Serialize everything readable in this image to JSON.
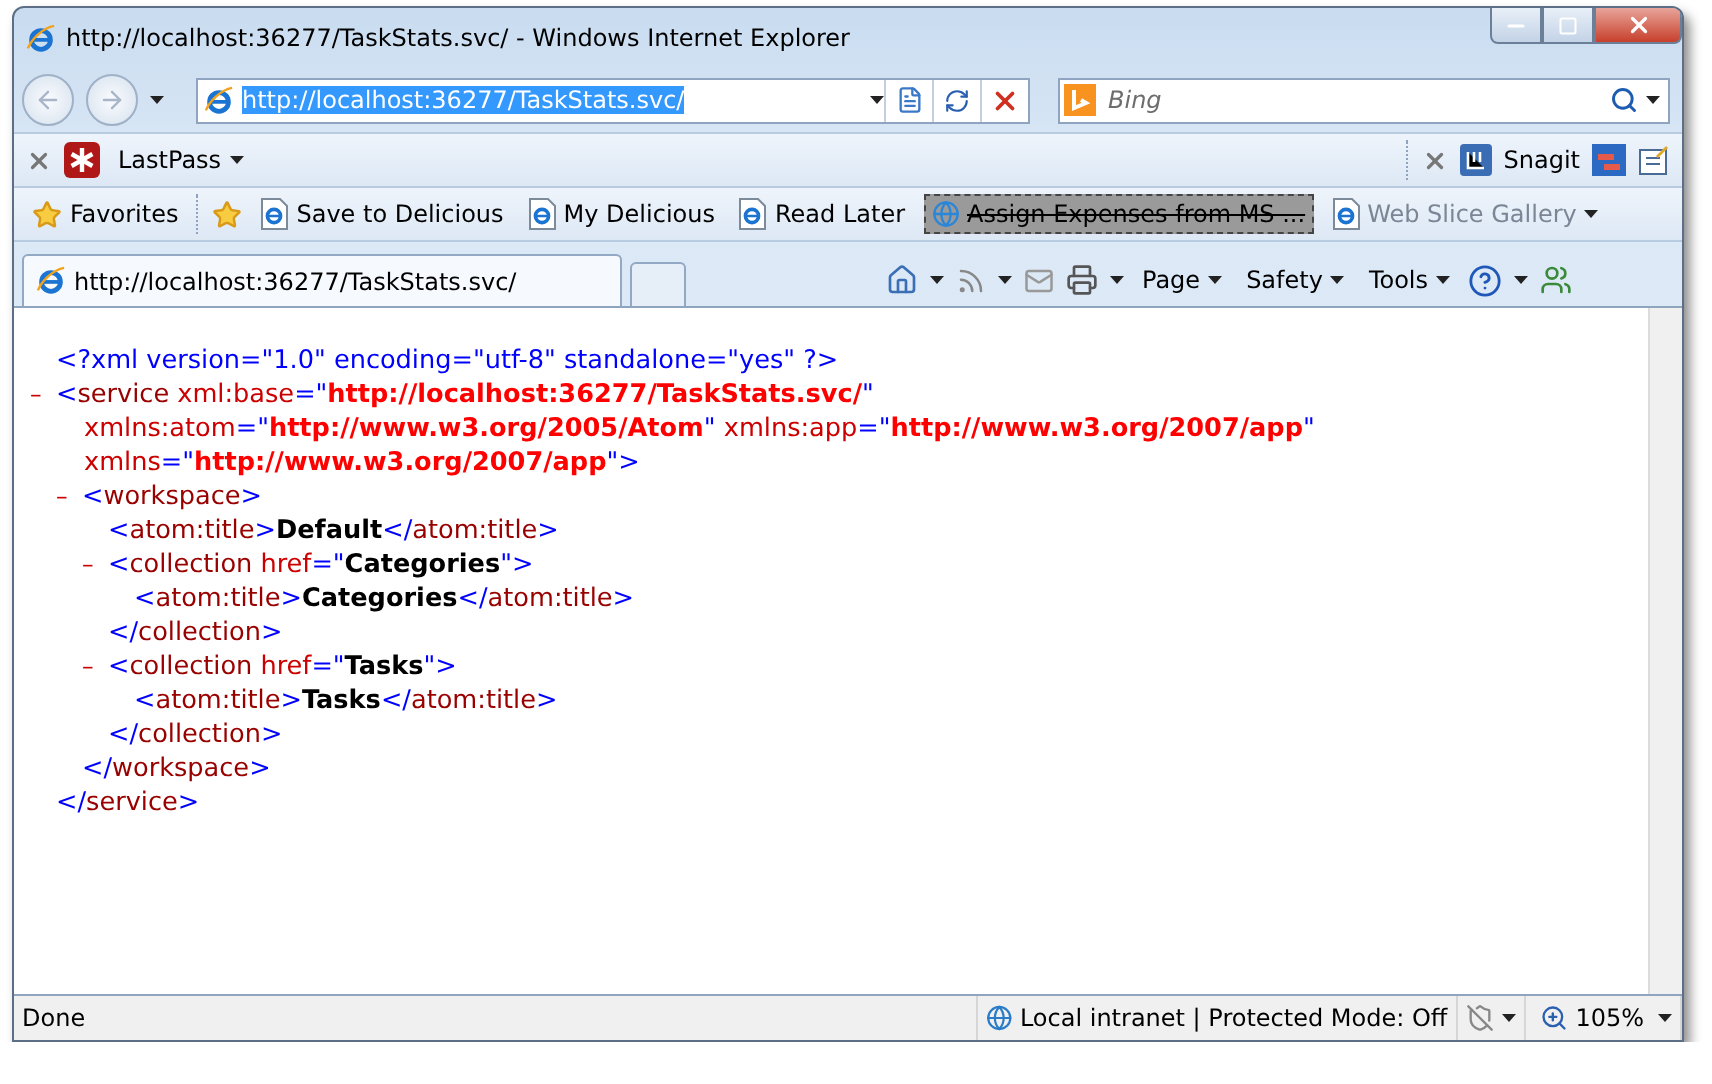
{
  "window": {
    "title": "http://localhost:36277/TaskStats.svc/ - Windows Internet Explorer"
  },
  "address_bar": {
    "value": "http://localhost:36277/TaskStats.svc/",
    "highlighted": true
  },
  "search": {
    "placeholder": "Bing"
  },
  "lastpass_toolbar": {
    "label": "LastPass"
  },
  "snagit_toolbar": {
    "label": "Snagit"
  },
  "favorites_bar": {
    "label": "Favorites",
    "links": [
      {
        "label": "Save to Delicious",
        "kind": "link",
        "disabled": false
      },
      {
        "label": "My Delicious",
        "kind": "link",
        "disabled": false
      },
      {
        "label": "Read Later",
        "kind": "link",
        "disabled": false
      },
      {
        "label": "Assign Expenses from MS ...",
        "kind": "dragging",
        "disabled": false
      },
      {
        "label": "Web Slice Gallery",
        "kind": "menu",
        "disabled": true
      }
    ]
  },
  "tabs": [
    {
      "label": "http://localhost:36277/TaskStats.svc/",
      "selected": true
    }
  ],
  "command_bar": {
    "menus": [
      "Page",
      "Safety",
      "Tools"
    ]
  },
  "document": {
    "prolog": [
      {
        "kind": "punct",
        "text": "<?xml version=\"1.0\" encoding=\"utf-8\" standalone=\"yes\" ?>"
      }
    ],
    "root": {
      "toggle": "–",
      "lines": [
        [
          {
            "kind": "punct",
            "text": "<"
          },
          {
            "kind": "tag",
            "text": "service"
          },
          {
            "kind": "attr",
            "text": " xml:base"
          },
          {
            "kind": "punct",
            "text": "=\""
          },
          {
            "kind": "value",
            "text": "http://localhost:36277/TaskStats.svc/"
          },
          {
            "kind": "punct",
            "text": "\""
          }
        ],
        [
          {
            "kind": "attr",
            "text": "xmlns:atom"
          },
          {
            "kind": "punct",
            "text": "=\""
          },
          {
            "kind": "value",
            "text": "http://www.w3.org/2005/Atom"
          },
          {
            "kind": "punct",
            "text": "\""
          },
          {
            "kind": "attr",
            "text": " xmlns:app"
          },
          {
            "kind": "punct",
            "text": "=\""
          },
          {
            "kind": "value",
            "text": "http://www.w3.org/2007/app"
          },
          {
            "kind": "punct",
            "text": "\""
          }
        ],
        [
          {
            "kind": "attr",
            "text": "xmlns"
          },
          {
            "kind": "punct",
            "text": "=\""
          },
          {
            "kind": "value",
            "text": "http://www.w3.org/2007/app"
          },
          {
            "kind": "punct",
            "text": "\">"
          }
        ]
      ],
      "children": [
        {
          "toggle": "–",
          "lines": [
            [
              {
                "kind": "punct",
                "text": "<"
              },
              {
                "kind": "tag",
                "text": "workspace"
              },
              {
                "kind": "punct",
                "text": ">"
              }
            ]
          ],
          "children": [
            {
              "lines": [
                [
                  {
                    "kind": "punct",
                    "text": "<"
                  },
                  {
                    "kind": "tag",
                    "text": "atom:title"
                  },
                  {
                    "kind": "punct",
                    "text": ">"
                  },
                  {
                    "kind": "text",
                    "text": "Default"
                  },
                  {
                    "kind": "punct",
                    "text": "</"
                  },
                  {
                    "kind": "tag",
                    "text": "atom:title"
                  },
                  {
                    "kind": "punct",
                    "text": ">"
                  }
                ]
              ]
            },
            {
              "toggle": "–",
              "lines": [
                [
                  {
                    "kind": "punct",
                    "text": "<"
                  },
                  {
                    "kind": "tag",
                    "text": "collection"
                  },
                  {
                    "kind": "attr",
                    "text": " href"
                  },
                  {
                    "kind": "punct",
                    "text": "=\""
                  },
                  {
                    "kind": "text",
                    "text": "Categories"
                  },
                  {
                    "kind": "punct",
                    "text": "\">"
                  }
                ]
              ],
              "children": [
                {
                  "lines": [
                    [
                      {
                        "kind": "punct",
                        "text": "<"
                      },
                      {
                        "kind": "tag",
                        "text": "atom:title"
                      },
                      {
                        "kind": "punct",
                        "text": ">"
                      },
                      {
                        "kind": "text",
                        "text": "Categories"
                      },
                      {
                        "kind": "punct",
                        "text": "</"
                      },
                      {
                        "kind": "tag",
                        "text": "atom:title"
                      },
                      {
                        "kind": "punct",
                        "text": ">"
                      }
                    ]
                  ]
                }
              ],
              "close": [
                {
                  "kind": "punct",
                  "text": "</"
                },
                {
                  "kind": "tag",
                  "text": "collection"
                },
                {
                  "kind": "punct",
                  "text": ">"
                }
              ]
            },
            {
              "toggle": "–",
              "lines": [
                [
                  {
                    "kind": "punct",
                    "text": "<"
                  },
                  {
                    "kind": "tag",
                    "text": "collection"
                  },
                  {
                    "kind": "attr",
                    "text": " href"
                  },
                  {
                    "kind": "punct",
                    "text": "=\""
                  },
                  {
                    "kind": "text",
                    "text": "Tasks"
                  },
                  {
                    "kind": "punct",
                    "text": "\">"
                  }
                ]
              ],
              "children": [
                {
                  "lines": [
                    [
                      {
                        "kind": "punct",
                        "text": "<"
                      },
                      {
                        "kind": "tag",
                        "text": "atom:title"
                      },
                      {
                        "kind": "punct",
                        "text": ">"
                      },
                      {
                        "kind": "text",
                        "text": "Tasks"
                      },
                      {
                        "kind": "punct",
                        "text": "</"
                      },
                      {
                        "kind": "tag",
                        "text": "atom:title"
                      },
                      {
                        "kind": "punct",
                        "text": ">"
                      }
                    ]
                  ]
                }
              ],
              "close": [
                {
                  "kind": "punct",
                  "text": "</"
                },
                {
                  "kind": "tag",
                  "text": "collection"
                },
                {
                  "kind": "punct",
                  "text": ">"
                }
              ]
            }
          ],
          "close": [
            {
              "kind": "punct",
              "text": "</"
            },
            {
              "kind": "tag",
              "text": "workspace"
            },
            {
              "kind": "punct",
              "text": ">"
            }
          ]
        }
      ],
      "close": [
        {
          "kind": "punct",
          "text": "</"
        },
        {
          "kind": "tag",
          "text": "service"
        },
        {
          "kind": "punct",
          "text": ">"
        }
      ]
    }
  },
  "status_bar": {
    "status": "Done",
    "zone": "Local intranet | Protected Mode: Off",
    "zoom": "105%"
  }
}
